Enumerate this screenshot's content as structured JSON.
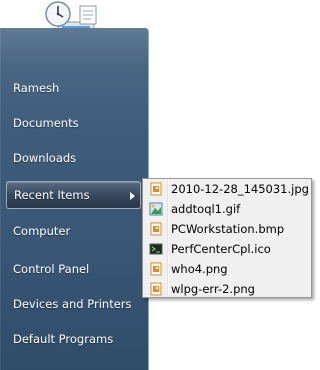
{
  "menu": {
    "items": [
      {
        "label": "Ramesh"
      },
      {
        "label": "Documents"
      },
      {
        "label": "Downloads"
      },
      {
        "label": "Recent Items"
      },
      {
        "label": "Computer"
      },
      {
        "label": "Control Panel"
      },
      {
        "label": "Devices and Printers"
      },
      {
        "label": "Default Programs"
      }
    ]
  },
  "recent_items": {
    "files": [
      {
        "name": "2010-12-28_145031.jpg",
        "icon": "image-file-icon"
      },
      {
        "name": "addtoql1.gif",
        "icon": "paint-image-icon"
      },
      {
        "name": "PCWorkstation.bmp",
        "icon": "image-file-icon"
      },
      {
        "name": "PerfCenterCpl.ico",
        "icon": "terminal-icon"
      },
      {
        "name": "who4.png",
        "icon": "image-file-icon"
      },
      {
        "name": "wlpg-err-2.png",
        "icon": "image-file-icon"
      }
    ]
  },
  "colors": {
    "pane_bg": "#3f5d7b",
    "submenu_bg": "#f0f0f0",
    "menu_text": "#ffffff"
  }
}
